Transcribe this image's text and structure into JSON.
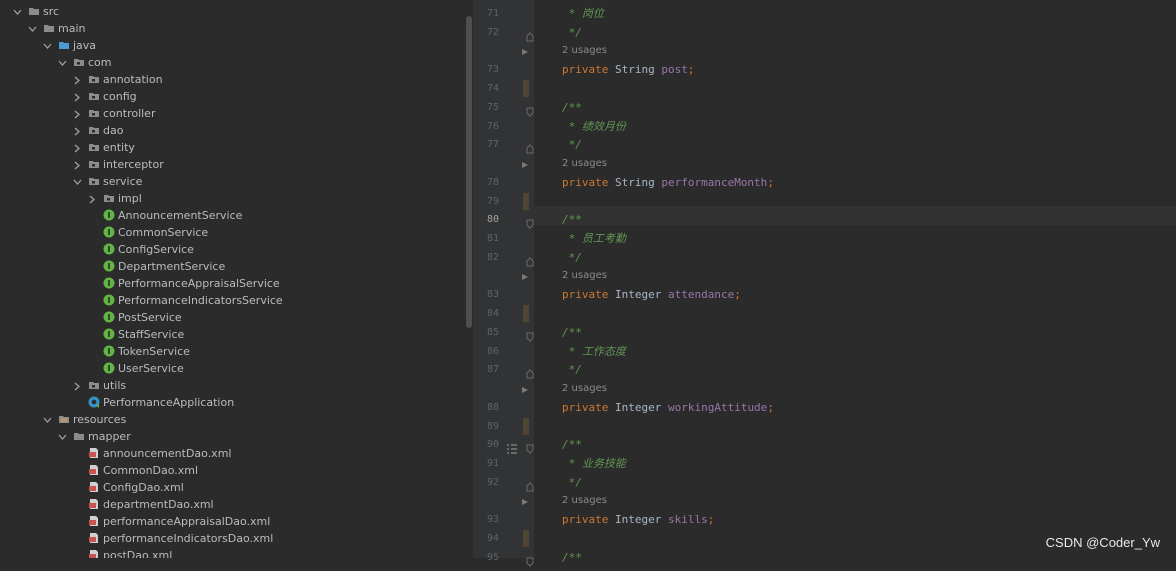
{
  "tree": {
    "rows": [
      {
        "label": "src",
        "kind": "folder",
        "arrow": "down"
      },
      {
        "label": "main",
        "kind": "folder",
        "arrow": "down"
      },
      {
        "label": "java",
        "kind": "folder-blue",
        "arrow": "down"
      },
      {
        "label": "com",
        "kind": "package",
        "arrow": "down"
      },
      {
        "label": "annotation",
        "kind": "package",
        "arrow": "right"
      },
      {
        "label": "config",
        "kind": "package",
        "arrow": "right"
      },
      {
        "label": "controller",
        "kind": "package",
        "arrow": "right"
      },
      {
        "label": "dao",
        "kind": "package",
        "arrow": "right"
      },
      {
        "label": "entity",
        "kind": "package",
        "arrow": "right"
      },
      {
        "label": "interceptor",
        "kind": "package",
        "arrow": "right"
      },
      {
        "label": "service",
        "kind": "package",
        "arrow": "down"
      },
      {
        "label": "impl",
        "kind": "package",
        "arrow": "right"
      },
      {
        "label": "AnnouncementService",
        "kind": "interface",
        "arrow": ""
      },
      {
        "label": "CommonService",
        "kind": "interface",
        "arrow": ""
      },
      {
        "label": "ConfigService",
        "kind": "interface",
        "arrow": ""
      },
      {
        "label": "DepartmentService",
        "kind": "interface",
        "arrow": ""
      },
      {
        "label": "PerformanceAppraisalService",
        "kind": "interface",
        "arrow": ""
      },
      {
        "label": "PerformanceIndicatorsService",
        "kind": "interface",
        "arrow": ""
      },
      {
        "label": "PostService",
        "kind": "interface",
        "arrow": ""
      },
      {
        "label": "StaffService",
        "kind": "interface",
        "arrow": ""
      },
      {
        "label": "TokenService",
        "kind": "interface",
        "arrow": ""
      },
      {
        "label": "UserService",
        "kind": "interface",
        "arrow": ""
      },
      {
        "label": "utils",
        "kind": "package",
        "arrow": "right"
      },
      {
        "label": "PerformanceApplication",
        "kind": "spring-class",
        "arrow": ""
      },
      {
        "label": "resources",
        "kind": "resources",
        "arrow": "down"
      },
      {
        "label": "mapper",
        "kind": "folder",
        "arrow": "down"
      },
      {
        "label": "announcementDao.xml",
        "kind": "xml",
        "arrow": ""
      },
      {
        "label": "CommonDao.xml",
        "kind": "xml",
        "arrow": ""
      },
      {
        "label": "ConfigDao.xml",
        "kind": "xml",
        "arrow": ""
      },
      {
        "label": "departmentDao.xml",
        "kind": "xml",
        "arrow": ""
      },
      {
        "label": "performanceAppraisalDao.xml",
        "kind": "xml",
        "arrow": ""
      },
      {
        "label": "performanceIndicatorsDao.xml",
        "kind": "xml",
        "arrow": ""
      },
      {
        "label": "postDao.xml",
        "kind": "xml",
        "arrow": ""
      }
    ]
  },
  "editor": {
    "current_line": "80",
    "usage_text": "2 usages",
    "lines": [
      {
        "num": "71",
        "type": "comment",
        "text": " * 岗位"
      },
      {
        "num": "72",
        "type": "comment",
        "text": " */"
      },
      {
        "num": "73",
        "type": "field",
        "kw": "private",
        "typ": "String",
        "name": "post"
      },
      {
        "num": "74",
        "type": "blank"
      },
      {
        "num": "75",
        "type": "comment",
        "text": "/**"
      },
      {
        "num": "76",
        "type": "comment",
        "text": " * 绩效月份"
      },
      {
        "num": "77",
        "type": "comment",
        "text": " */"
      },
      {
        "num": "78",
        "type": "field",
        "kw": "private",
        "typ": "String",
        "name": "performanceMonth"
      },
      {
        "num": "79",
        "type": "blank"
      },
      {
        "num": "80",
        "type": "comment",
        "text": "/**"
      },
      {
        "num": "81",
        "type": "comment",
        "text": " * 员工考勤"
      },
      {
        "num": "82",
        "type": "comment",
        "text": " */"
      },
      {
        "num": "83",
        "type": "field",
        "kw": "private",
        "typ": "Integer",
        "name": "attendance"
      },
      {
        "num": "84",
        "type": "blank"
      },
      {
        "num": "85",
        "type": "comment",
        "text": "/**"
      },
      {
        "num": "86",
        "type": "comment",
        "text": " * 工作态度"
      },
      {
        "num": "87",
        "type": "comment",
        "text": " */"
      },
      {
        "num": "88",
        "type": "field",
        "kw": "private",
        "typ": "Integer",
        "name": "workingAttitude"
      },
      {
        "num": "89",
        "type": "blank"
      },
      {
        "num": "90",
        "type": "comment",
        "text": "/**"
      },
      {
        "num": "91",
        "type": "comment",
        "text": " * 业务技能"
      },
      {
        "num": "92",
        "type": "comment",
        "text": " */"
      },
      {
        "num": "93",
        "type": "field",
        "kw": "private",
        "typ": "Integer",
        "name": "skills"
      },
      {
        "num": "94",
        "type": "blank"
      },
      {
        "num": "95",
        "type": "comment",
        "text": "/**"
      }
    ]
  },
  "watermark": "CSDN @Coder_Yw",
  "colors": {
    "interface_icon": "#62b543",
    "folder_icon": "#8c8c8c",
    "java_folder_icon": "#4a9cd6",
    "xml_icon": "#c75450",
    "comment": "#629755",
    "keyword": "#cc7832",
    "field": "#9876aa"
  }
}
